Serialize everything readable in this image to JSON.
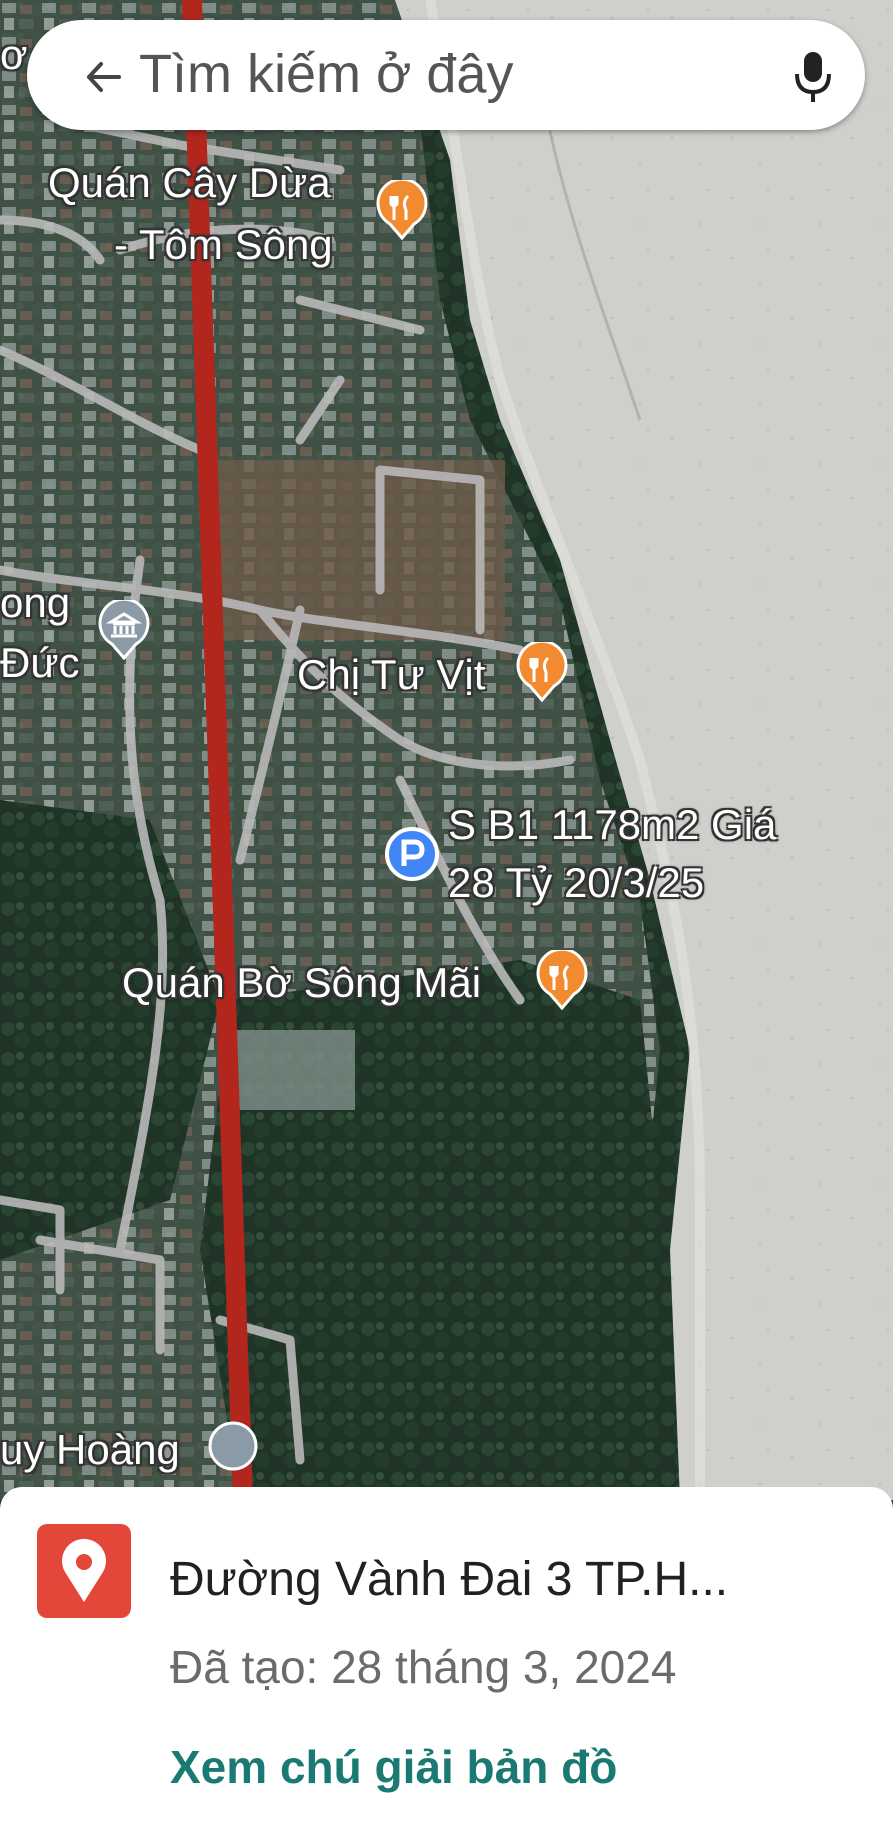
{
  "search": {
    "placeholder": "Tìm kiếm ở đây"
  },
  "map": {
    "labels": {
      "cay_dua_1": "Quán Cây Dừa",
      "cay_dua_2": "- Tôm Sông",
      "long": "ong",
      "duc": "Đức",
      "chi_tu_vit": "Chị Tư Vịt",
      "lot_1": "S B1 1178m2 Giá",
      "lot_2": "28 Tỷ 20/3/25",
      "bo_song_mai": "Quán Bờ Sông Mãi",
      "huy_hoang": "uy Hoàng",
      "top_left": "ơ"
    },
    "colors": {
      "route": "#b3261e",
      "restaurant_pin": "#f28b30",
      "parking_pin": "#4285f4",
      "landmark_pin": "#8a9aa6"
    }
  },
  "place": {
    "title": "Đường Vành Đai 3 TP.H...",
    "created": "Đã tạo: 28 tháng 3, 2024",
    "legend_link": "Xem chú giải bản đồ",
    "icon_color": "#e3473a"
  }
}
